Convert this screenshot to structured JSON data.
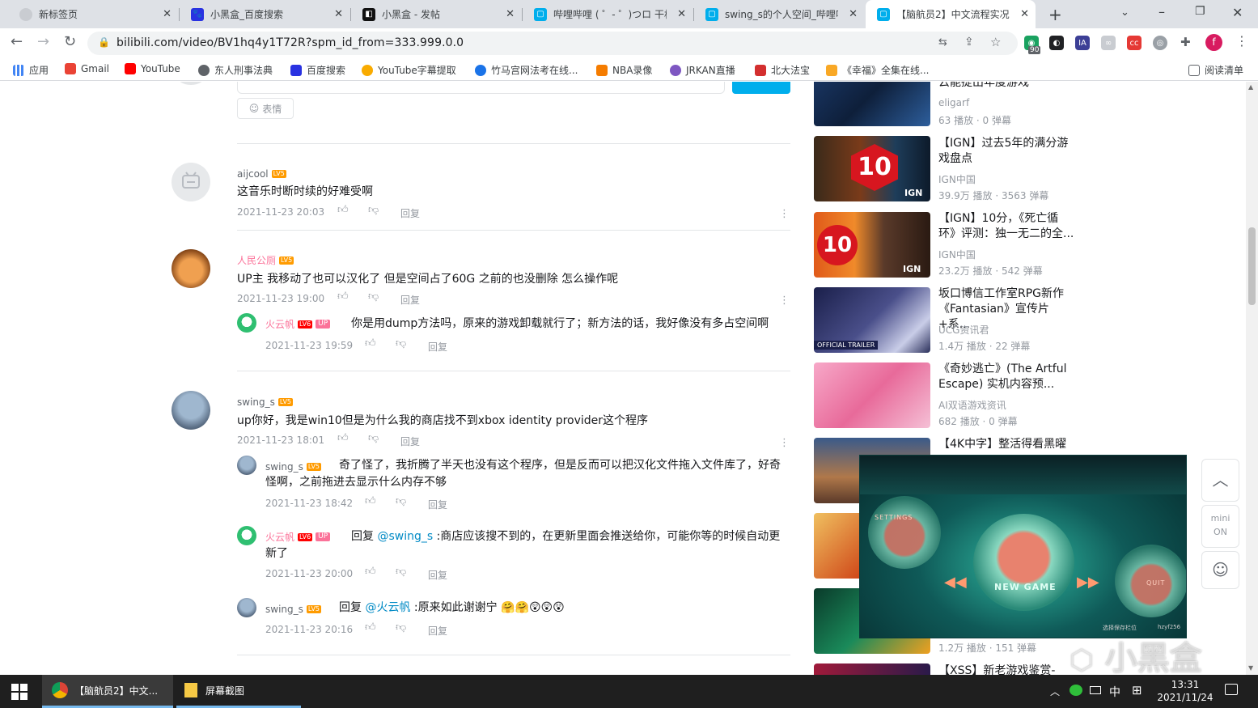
{
  "tabs": [
    {
      "label": "新标签页",
      "active": false
    },
    {
      "label": "小黑盒_百度搜索",
      "active": false
    },
    {
      "label": "小黑盒 - 发帖",
      "active": false
    },
    {
      "label": "哔哩哔哩 ( ゜- ゜)つロ 干杯~",
      "active": false
    },
    {
      "label": "swing_s的个人空间_哔哩哔",
      "active": false
    },
    {
      "label": "【脑航员2】中文流程实况",
      "active": true
    }
  ],
  "toolbar": {
    "url": "bilibili.com/video/BV1hq4y1T72R?spm_id_from=333.999.0.0",
    "ext_badge": "90"
  },
  "bookmarks": [
    {
      "label": "应用"
    },
    {
      "label": "Gmail"
    },
    {
      "label": "YouTube"
    },
    {
      "label": "东人刑事法典"
    },
    {
      "label": "百度搜索"
    },
    {
      "label": "YouTube字幕提取"
    },
    {
      "label": "竹马宫网法考在线..."
    },
    {
      "label": "NBA录像"
    },
    {
      "label": "JRKAN直播"
    },
    {
      "label": "北大法宝"
    },
    {
      "label": "《幸福》全集在线..."
    }
  ],
  "reading_list": "阅读清单",
  "comment_box": {
    "emoji_label": "表情"
  },
  "comments": [
    {
      "user": "aijcool",
      "level": "LV5",
      "text": "这音乐时断时续的好难受啊",
      "time": "2021-11-23 20:03",
      "reply_label": "回复"
    },
    {
      "user": "人民公厕",
      "level": "LV5",
      "text": "UP主 我移动了也可以汉化了 但是空间占了60G 之前的也没删除 怎么操作呢",
      "time": "2021-11-23 19:00",
      "reply_label": "回复",
      "replies": [
        {
          "user": "火云帆",
          "level": "LV6",
          "up": "UP",
          "text": "你是用dump方法吗，原来的游戏卸载就行了；新方法的话，我好像没有多占空间啊",
          "time": "2021-11-23 19:59",
          "reply_label": "回复"
        }
      ]
    },
    {
      "user": "swing_s",
      "level": "LV5",
      "text": "up你好，我是win10但是为什么我的商店找不到xbox identity provider这个程序",
      "time": "2021-11-23 18:01",
      "reply_label": "回复",
      "replies": [
        {
          "user": "swing_s",
          "level": "LV5",
          "text_line1": "奇了怪了，我折腾了半天也没有这个程序，但是反而可以把汉化文件拖入文件库了，好奇",
          "text_line2": "怪啊，之前拖进去显示什么内存不够",
          "time": "2021-11-23 18:42",
          "reply_label": "回复"
        },
        {
          "user": "火云帆",
          "level": "LV6",
          "up": "UP",
          "reply_prefix": "回复",
          "mention": "@swing_s",
          "text_line1": ":商店应该搜不到的，在更新里面会推送给你，可能你等的时候自动更",
          "text_line2": "新了",
          "time": "2021-11-23 20:00",
          "reply_label": "回复"
        },
        {
          "user": "swing_s",
          "level": "LV5",
          "reply_prefix": "回复",
          "mention": "@火云帆",
          "text": ":原来如此谢谢宁",
          "emojis": "🤗🤗😲😲😲",
          "time": "2021-11-23 20:16",
          "reply_label": "回复"
        }
      ]
    }
  ],
  "sidebar_videos": [
    {
      "title_line2": "云能提出年度游戏",
      "author": "eligarf",
      "stats": "63 播放 · 0 弹幕"
    },
    {
      "title_line1": "【IGN】过去5年的满分游",
      "title_line2": "戏盘点",
      "author": "IGN中国",
      "stats": "39.9万 播放 · 3563 弹幕",
      "badge": "10"
    },
    {
      "title_line1": "【IGN】10分，《死亡循",
      "title_line2": "环》评测：独一无二的全...",
      "author": "IGN中国",
      "stats": "23.2万 播放 · 542 弹幕",
      "badge": "10"
    },
    {
      "title_line1": "坂口博信工作室RPG新作",
      "title_line2": "《Fantasian》宣传片+系...",
      "author": "UCG资讯君",
      "stats": "1.4万 播放 · 22 弹幕",
      "thumb_text": "OFFICIAL TRAILER"
    },
    {
      "title_line1": "《奇妙逃亡》(The Artful",
      "title_line2": "Escape) 实机内容预...",
      "author": "AI双语游戏资讯",
      "stats": "682 播放 · 0 弹幕"
    },
    {
      "title_line1": "【4K中字】整活得看黑曜"
    },
    {
      "stats": "1.2万 播放 · 151 弹幕"
    },
    {
      "title_line1": "【XSS】新老游戏鉴赏-"
    }
  ],
  "mini_player": {
    "menu_left": "SETTINGS",
    "menu_center": "NEW GAME",
    "menu_right": "QUIT",
    "status": "选择保存栏位",
    "status2": "hzyf256"
  },
  "side_buttons": {
    "mini_label1": "mini",
    "mini_label2": "ON"
  },
  "watermark": "小黑盒",
  "taskbar": {
    "app1": "【脑航员2】中文...",
    "app2": "屏幕截图",
    "ime": "中",
    "time": "13:31",
    "date": "2021/11/24"
  },
  "colors": {
    "accent": "#00aeec",
    "up_pink": "#fb7299",
    "lv5": "#ff9b00",
    "lv6": "#ff0000",
    "mention": "#008ac5"
  }
}
